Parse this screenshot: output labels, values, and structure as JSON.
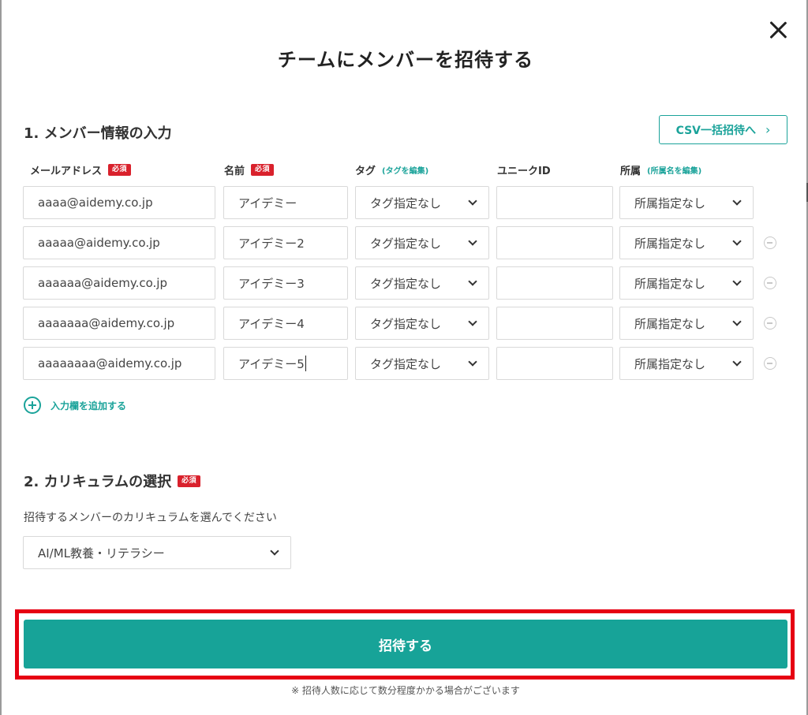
{
  "dialog": {
    "title": "チームにメンバーを招待する",
    "close_icon": "close-icon"
  },
  "section1": {
    "heading": "1. メンバー情報の入力",
    "csv_button_label": "CSV一括招待へ",
    "csv_chevron": "›",
    "required_label": "必須",
    "columns": {
      "email": "メールアドレス",
      "name": "名前",
      "tag": "タグ",
      "tag_link": "(タグを編集)",
      "unique_id": "ユニークID",
      "affiliation": "所属",
      "affiliation_link": "(所属名を編集)"
    },
    "rows": [
      {
        "email": "aaaa@aidemy.co.jp",
        "name": "アイデミー",
        "tag": "タグ指定なし",
        "unique_id": "",
        "affiliation": "所属指定なし"
      },
      {
        "email": "aaaaa@aidemy.co.jp",
        "name": "アイデミー2",
        "tag": "タグ指定なし",
        "unique_id": "",
        "affiliation": "所属指定なし"
      },
      {
        "email": "aaaaaa@aidemy.co.jp",
        "name": "アイデミー3",
        "tag": "タグ指定なし",
        "unique_id": "",
        "affiliation": "所属指定なし"
      },
      {
        "email": "aaaaaaa@aidemy.co.jp",
        "name": "アイデミー4",
        "tag": "タグ指定なし",
        "unique_id": "",
        "affiliation": "所属指定なし"
      },
      {
        "email": "aaaaaaaa@aidemy.co.jp",
        "name": "アイデミー5",
        "tag": "タグ指定なし",
        "unique_id": "",
        "affiliation": "所属指定なし"
      }
    ],
    "add_row_label": "入力欄を追加する"
  },
  "section2": {
    "heading": "2. カリキュラムの選択",
    "required_label": "必須",
    "description": "招待するメンバーのカリキュラムを選んでください",
    "selected_curriculum": "AI/ML教養・リテラシー"
  },
  "footer": {
    "invite_button_label": "招待する",
    "note": "※ 招待人数に応じて数分程度かかる場合がございます"
  },
  "colors": {
    "accent": "#1ba39a",
    "button": "#17a398",
    "required": "#d9212c",
    "highlight": "#e60012"
  }
}
